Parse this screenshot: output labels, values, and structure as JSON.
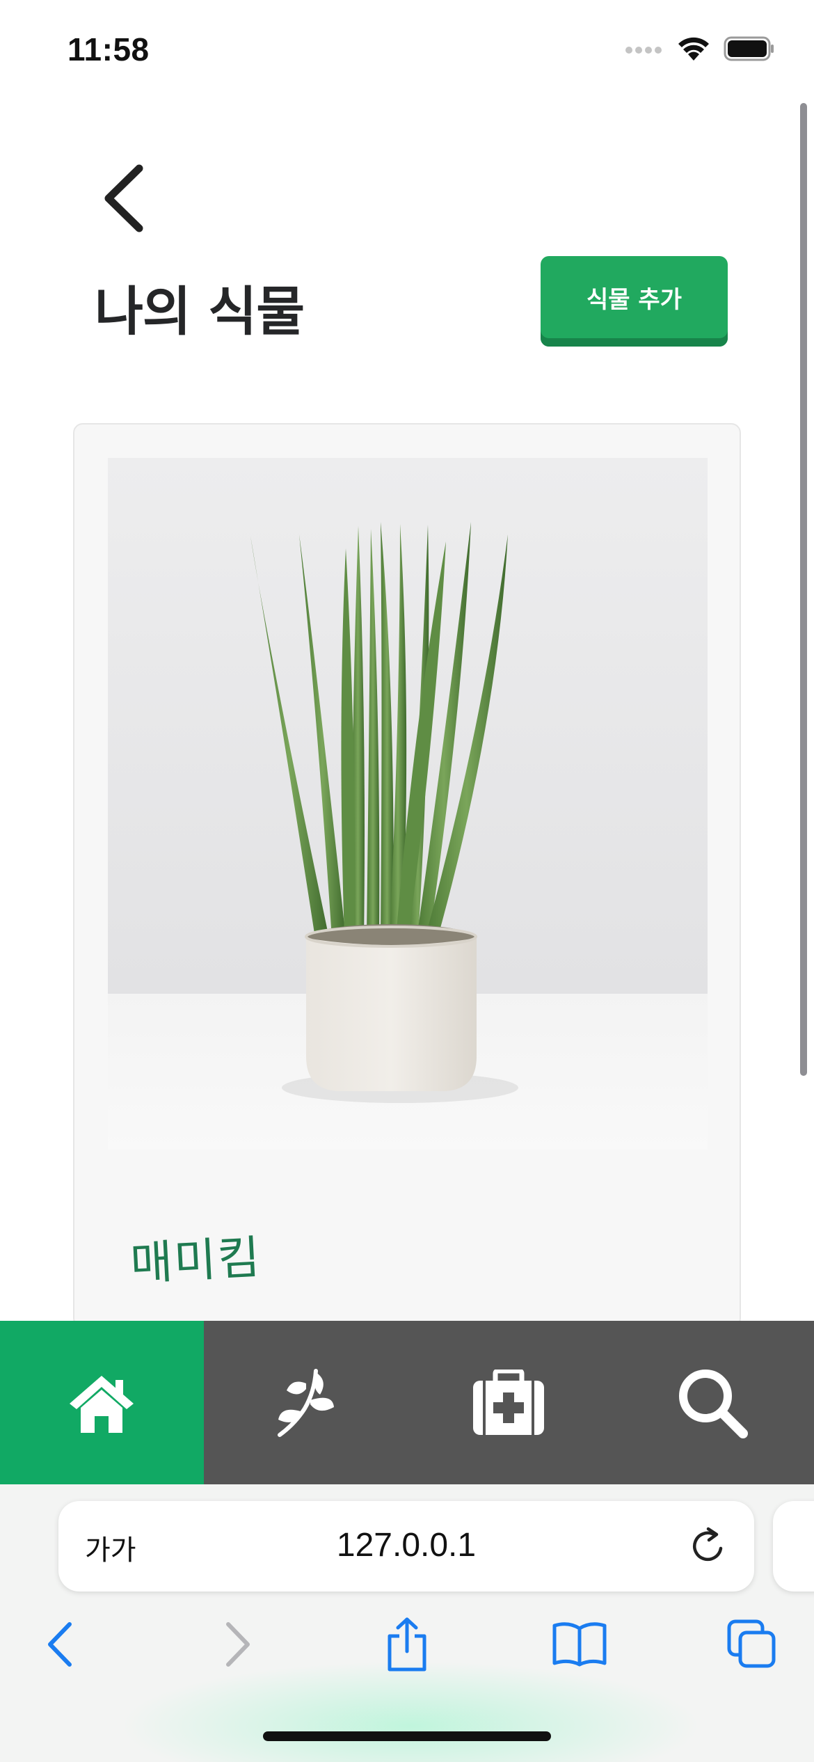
{
  "status_bar": {
    "time": "11:58"
  },
  "header": {
    "title": "나의 식물",
    "add_button_label": "식물 추가"
  },
  "plants": [
    {
      "name": "매미킴"
    }
  ],
  "bottom_nav": {
    "items": [
      "home",
      "plants",
      "health",
      "search"
    ],
    "active": "home"
  },
  "browser": {
    "aa_label": "가가",
    "url": "127.0.0.1"
  },
  "colors": {
    "accent": "#21a95f",
    "nav_active": "#11a964",
    "nav_bg": "#555555",
    "title": "#252628",
    "browser_blue": "#1a7cf0"
  }
}
